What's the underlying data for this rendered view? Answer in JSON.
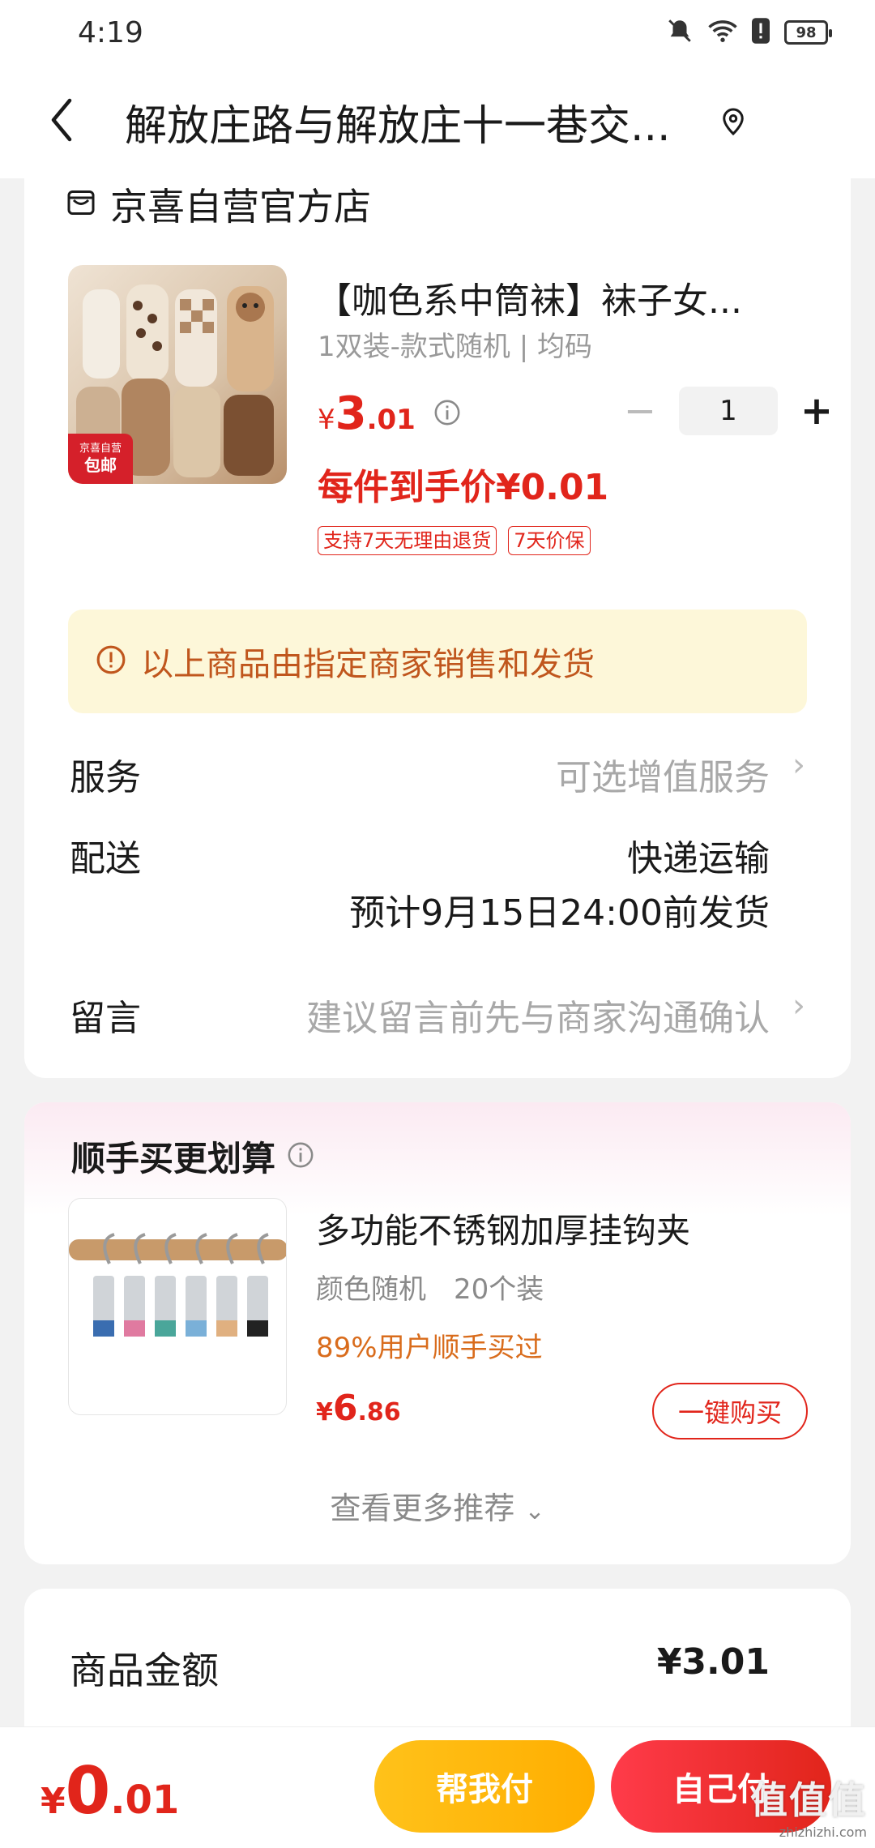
{
  "status": {
    "time": "4:19",
    "battery": "98"
  },
  "header": {
    "title": "解放庄路与解放庄十一巷交..."
  },
  "store": {
    "name": "京喜自营官方店"
  },
  "product": {
    "title": "【咖色系中筒袜】袜子女...",
    "spec": "1双装-款式随机 | 均码",
    "badge_top": "京喜自营",
    "badge_bottom": "包邮",
    "price_yen": "¥",
    "price_int": "3",
    "price_dec": ".01",
    "per_price": "每件到手价¥0.01",
    "tags": [
      "支持7天无理由退货",
      "7天价保"
    ],
    "quantity": "1",
    "qty_minus": "−",
    "qty_plus": "+"
  },
  "notice": {
    "text": "以上商品由指定商家销售和发货"
  },
  "service": {
    "label": "服务",
    "value": "可选增值服务"
  },
  "delivery": {
    "label": "配送",
    "method": "快递运输",
    "eta": "预计9月15日24:00前发货"
  },
  "message": {
    "label": "留言",
    "placeholder": "建议留言前先与商家沟通确认"
  },
  "recommend": {
    "title": "顺手买更划算",
    "item": {
      "name": "多功能不锈钢加厚挂钩夹",
      "spec": "颜色随机　20个装",
      "sold": "89%用户顺手买过",
      "price_yen": "¥",
      "price_int": "6",
      "price_dec": ".86",
      "button": "一键购买"
    },
    "more": "查看更多推荐"
  },
  "summary": {
    "label": "商品金额",
    "value": "¥3.01"
  },
  "bottom": {
    "total_yen": "¥",
    "total_int": "0",
    "total_dec": ".01",
    "help_pay": "帮我付",
    "self_pay": "自己付"
  },
  "watermark": {
    "logo": "值值值",
    "url": "zhizhizhi.com"
  },
  "colors": {
    "accent": "#e1251b",
    "notice_bg": "#fdf7d9",
    "notice_text": "#c0561d",
    "help_btn": "#ffb800"
  }
}
